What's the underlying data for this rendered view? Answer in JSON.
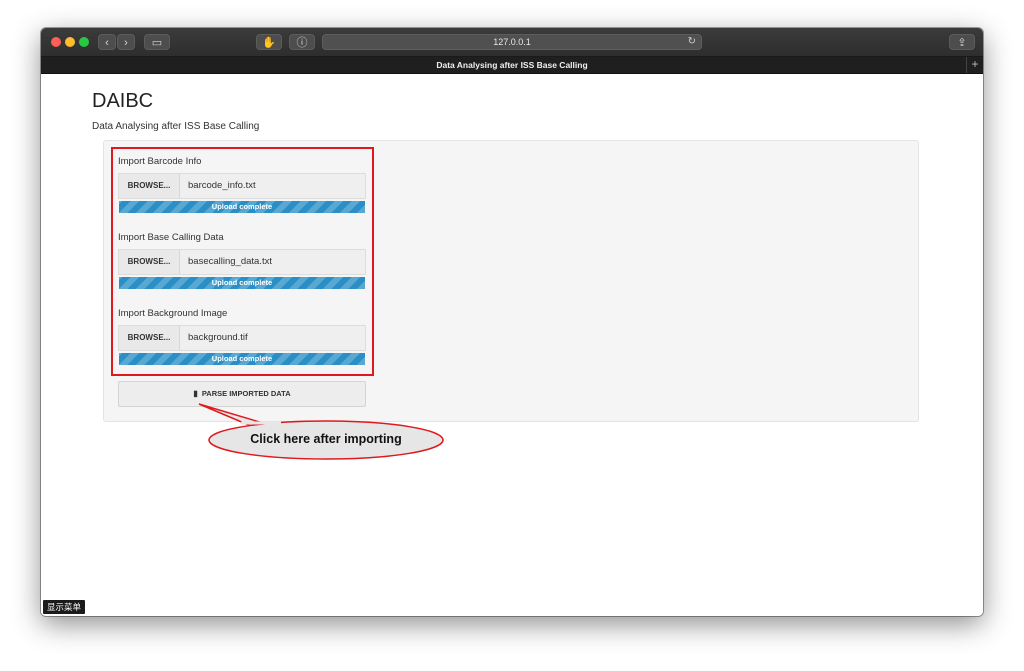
{
  "browser": {
    "url": "127.0.0.1",
    "tab_title": "Data Analysing after ISS Base Calling",
    "icons": {
      "back": "chevron-left-icon",
      "forward": "chevron-right-icon",
      "sidebar": "sidebar-icon",
      "reload": "reload-icon",
      "share": "share-icon",
      "new_tab": "plus-icon"
    },
    "glyphs": {
      "back": "‹",
      "forward": "›",
      "sidebar": "▭",
      "ext1": "✋",
      "ext2": "ⓘ",
      "reload": "↻",
      "share": "⇪",
      "new_tab": "+"
    }
  },
  "app": {
    "title": "DAIBC",
    "subtitle": "Data Analysing after ISS Base Calling"
  },
  "inputs": [
    {
      "label": "Import Barcode Info",
      "browse_label": "BROWSE...",
      "file_name": "barcode_info.txt",
      "progress_text": "Upload complete",
      "progress": 1.0
    },
    {
      "label": "Import Base Calling Data",
      "browse_label": "BROWSE...",
      "file_name": "basecalling_data.txt",
      "progress_text": "Upload complete",
      "progress": 1.0
    },
    {
      "label": "Import Background Image",
      "browse_label": "BROWSE...",
      "file_name": "background.tif",
      "progress_text": "Upload complete",
      "progress": 1.0
    }
  ],
  "parse_button": {
    "label": "PARSE IMPORTED DATA",
    "icon": "memory-chip-icon",
    "glyph": "▮"
  },
  "annotation": {
    "text": "Click here after importing"
  },
  "footer": {
    "menu_label": "显示菜单"
  },
  "colors": {
    "progress": "#2a8fc6",
    "highlight": "#e0191e",
    "traffic_red": "#fe5f57",
    "traffic_yellow": "#febc2e",
    "traffic_green": "#28c840"
  }
}
